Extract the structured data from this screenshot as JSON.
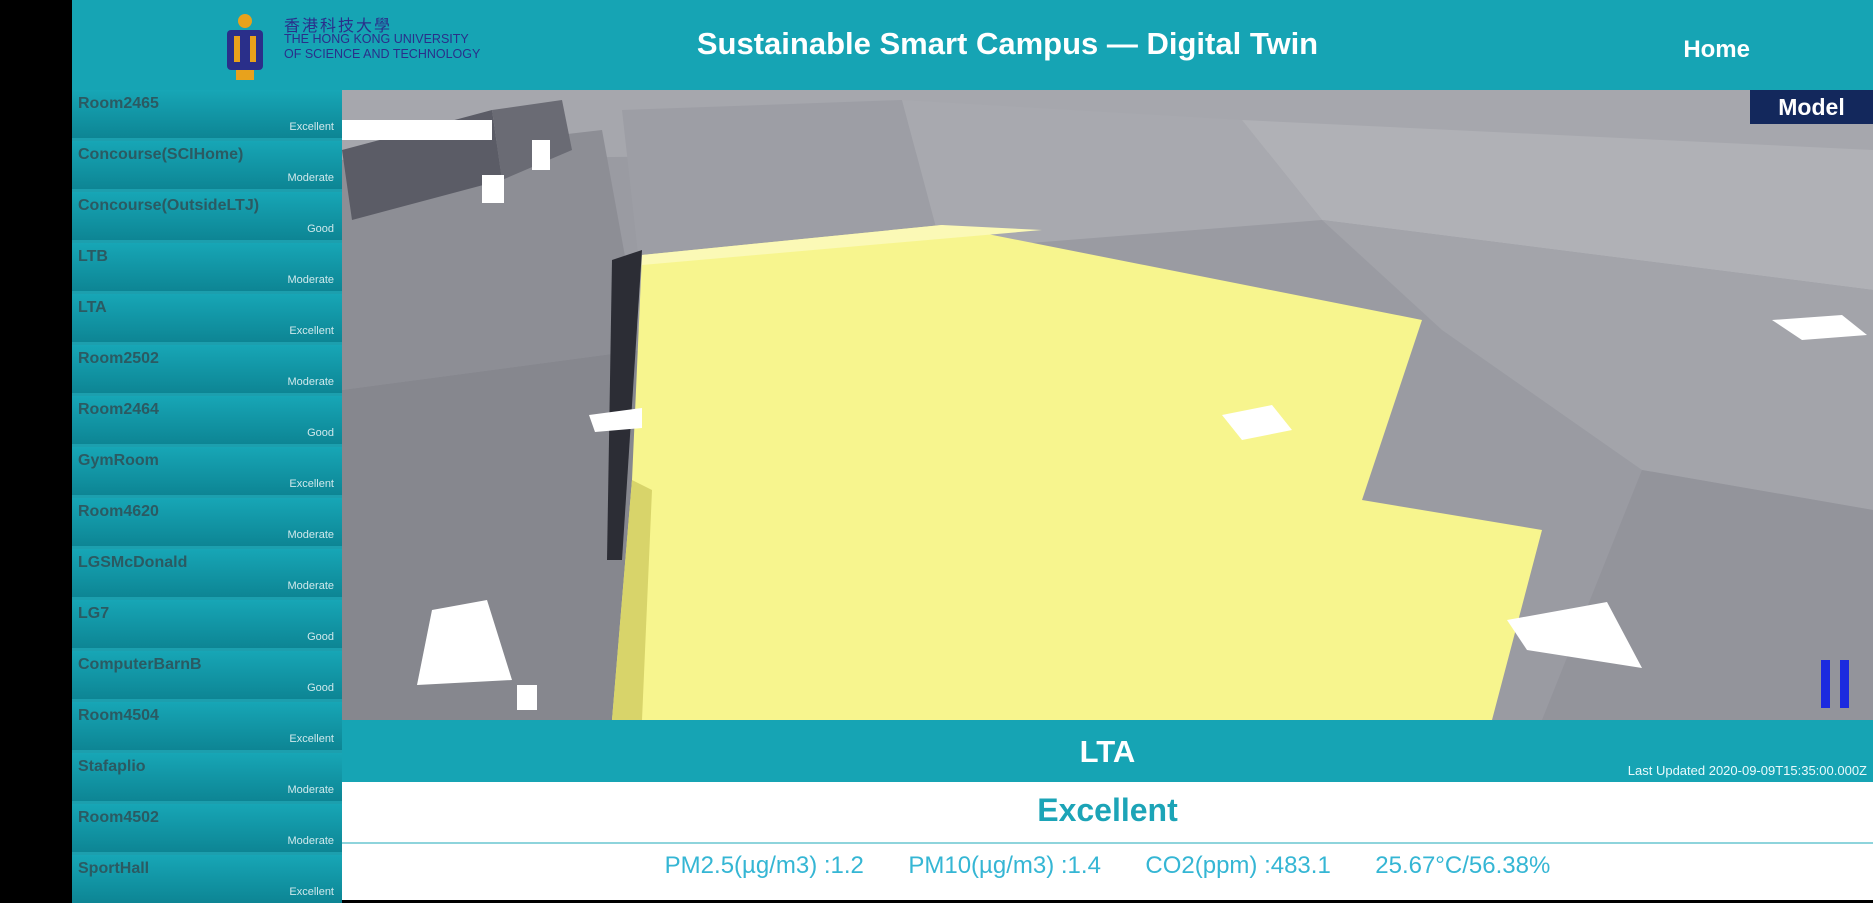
{
  "header": {
    "logo_cn": "香港科技大學",
    "logo_en": "THE HONG KONG UNIVERSITY OF SCIENCE AND TECHNOLOGY",
    "title": "Sustainable Smart Campus — Digital Twin",
    "home_label": "Home"
  },
  "sidebar": {
    "items": [
      {
        "name": "Room2465",
        "status": "Excellent"
      },
      {
        "name": "Concourse(SCIHome)",
        "status": "Moderate"
      },
      {
        "name": "Concourse(OutsideLTJ)",
        "status": "Good"
      },
      {
        "name": "LTB",
        "status": "Moderate"
      },
      {
        "name": "LTA",
        "status": "Excellent"
      },
      {
        "name": "Room2502",
        "status": "Moderate"
      },
      {
        "name": "Room2464",
        "status": "Good"
      },
      {
        "name": "GymRoom",
        "status": "Excellent"
      },
      {
        "name": "Room4620",
        "status": "Moderate"
      },
      {
        "name": "LGSMcDonald",
        "status": "Moderate"
      },
      {
        "name": "LG7",
        "status": "Good"
      },
      {
        "name": "ComputerBarnB",
        "status": "Good"
      },
      {
        "name": "Room4504",
        "status": "Excellent"
      },
      {
        "name": "Stafaplio",
        "status": "Moderate"
      },
      {
        "name": "Room4502",
        "status": "Moderate"
      },
      {
        "name": "SportHall",
        "status": "Excellent"
      }
    ]
  },
  "viewport": {
    "model_label": "Model",
    "pause_icon": "pause-icon",
    "highlight_color": "#f7f58e"
  },
  "info": {
    "room": "LTA",
    "last_updated": "Last Updated 2020-09-09T15:35:00.000Z",
    "status": "Excellent",
    "metrics": {
      "pm25": "PM2.5(µg/m3) :1.2",
      "pm10": "PM10(µg/m3) :1.4",
      "co2": "CO2(ppm) :483.1",
      "temp_humidity": "25.67°C/56.38%"
    }
  },
  "colors": {
    "header_bg": "#16a4b4",
    "model_btn": "#13285c",
    "pause": "#1b2adf",
    "status_text": "#1ca4b7"
  }
}
